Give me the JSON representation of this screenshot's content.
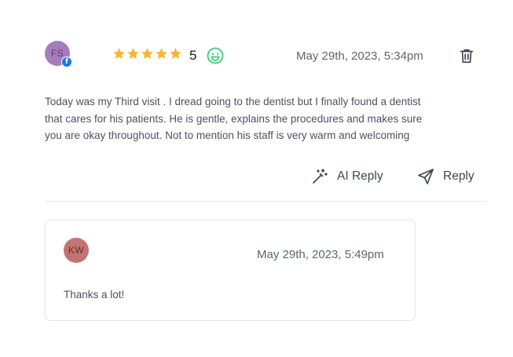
{
  "review": {
    "author_initials": "FS",
    "source_icon": "facebook-icon",
    "rating_stars": 5,
    "rating_value": "5",
    "sentiment_icon": "smile-icon",
    "timestamp": "May 29th, 2023, 5:34pm",
    "text": "Today was my Third visit . I dread going to the dentist but I finally found a dentist that cares for his patients. He is gentle, explains the procedures and makes sure you are okay throughout. Not to mention his staff is very warm and welcoming"
  },
  "actions": {
    "ai_reply_label": "AI Reply",
    "reply_label": "Reply"
  },
  "response": {
    "author_initials": "KW",
    "timestamp": "May 29th, 2023, 5:49pm",
    "text": "Thanks a lot!"
  },
  "colors": {
    "star": "#f5b731",
    "smile": "#4ccf82",
    "facebook": "#1877f2",
    "avatar_fs": "#a57dbd",
    "avatar_kw": "#c27471"
  }
}
